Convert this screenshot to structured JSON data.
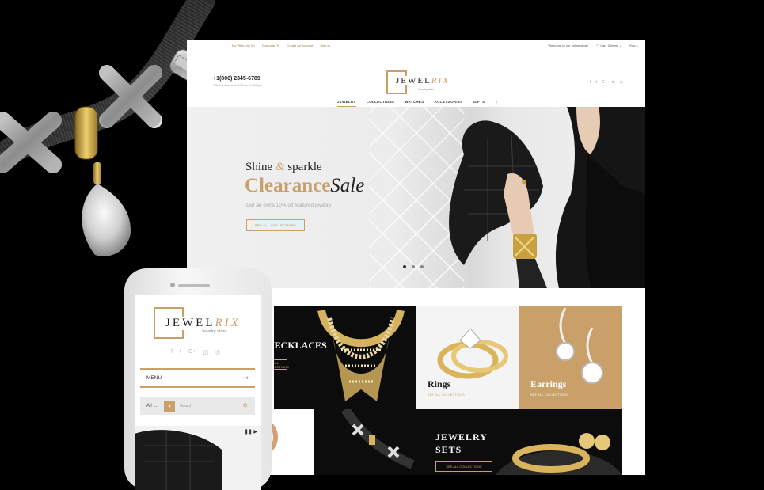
{
  "site": {
    "topbar": {
      "links": [
        "My Wish List (0)",
        "Compare (0)",
        "Create an Account",
        "Sign In"
      ],
      "welcome": "Welcome to our online store!",
      "cart": "Cart: 0 items",
      "lang": "Eng"
    },
    "header": {
      "phone": "+1(800) 2345-6789",
      "hours": "7 days a week from 9:00 am to 7:00 pm",
      "logo_main": "JEWEL",
      "logo_accent": "RIX",
      "logo_sub": "Jewelry store",
      "socials": [
        "f",
        "t",
        "G+",
        "in",
        "◎"
      ]
    },
    "nav": [
      "JEWELRY",
      "COLLECTIONS",
      "WATCHES",
      "ACCESSORIES",
      "GIFTS"
    ],
    "hero": {
      "subtitle_a": "Shine",
      "subtitle_amp": "&",
      "subtitle_b": "sparkle",
      "title_a": "Clearance",
      "title_b": "Sale",
      "offer": "Get an extra 10% off featured jewelry",
      "button": "SEE ALL COLLECTIONS"
    },
    "tiles": {
      "necklaces": "NECKLACES",
      "necklaces_link": "SEE ALL COLLECTIONS",
      "rings": "Rings",
      "rings_link": "SEE ALL COLLECTIONS",
      "earrings": "Earrings",
      "earrings_link": "SEE ALL COLLECTIONS",
      "sets_line1": "JEWELRY",
      "sets_line2": "SETS",
      "sets_link": "SEE ALL COLLECTIONS"
    }
  },
  "mobile": {
    "logo_main": "JEWEL",
    "logo_accent": "RIX",
    "logo_sub": "Jewelry store",
    "socials": [
      "f",
      "t",
      "G+",
      "◫",
      "◎"
    ],
    "menu": "MENU",
    "search_category": "All ...",
    "search_placeholder": "Search"
  },
  "colors": {
    "gold": "#c9a06a",
    "dark": "#0c0c0c"
  }
}
